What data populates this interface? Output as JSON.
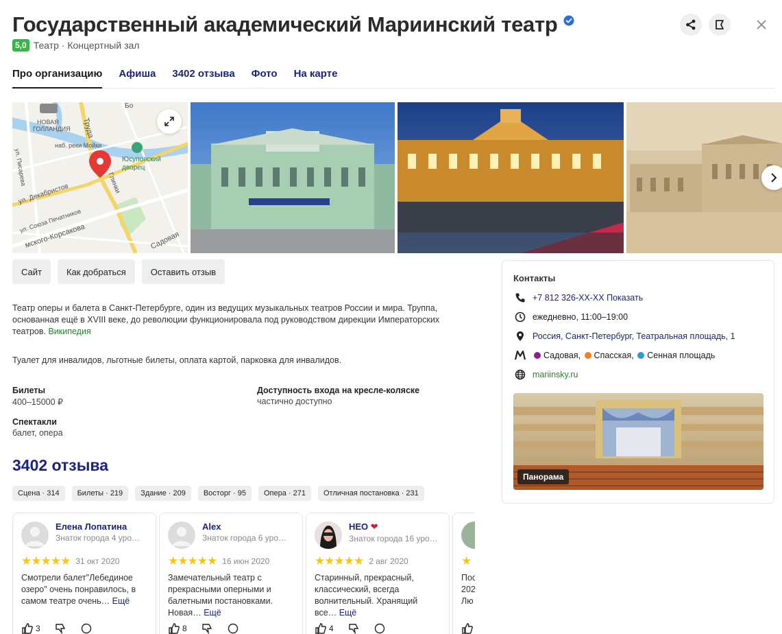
{
  "header": {
    "title": "Государственный академический Мариинский театр",
    "rating": "5,0",
    "categories": "Театр · Концертный зал"
  },
  "tabs": [
    {
      "label": "Про организацию",
      "active": true
    },
    {
      "label": "Афиша",
      "active": false
    },
    {
      "label": "3402 отзыва",
      "active": false
    },
    {
      "label": "Фото",
      "active": false
    },
    {
      "label": "На карте",
      "active": false
    }
  ],
  "map": {
    "labels": {
      "gollandia": "НОВАЯ\nГОЛЛАНДИЯ",
      "truda": "Труда",
      "moika": "наб. реки Мойки",
      "yusupov": "Юсуповский\nдворец",
      "pisareva": "ул. Писарева",
      "dekabristov": "ул. Декабристов",
      "glinki": "Глинки",
      "pechatnikov": "ул. Союза Печатников",
      "korsakova": "мского-Корсакова",
      "sadovaya": "Садовая",
      "bo": "Бо"
    }
  },
  "actions": {
    "site": "Сайт",
    "route": "Как добраться",
    "review": "Оставить отзыв"
  },
  "about": {
    "description": "Театр оперы и балета в Санкт-Петербурге, один из ведущих музыкальных театров России и мира. Труппа, основанная ещё в XVIII веке, до революции функционировала под руководством дирекции Императорских театров.",
    "wiki_link": "Википедия",
    "features": "Туалет для инвалидов, льготные билеты, оплата картой, парковка для инвалидов."
  },
  "facts": {
    "tickets_label": "Билеты",
    "tickets_value": "400–15000 ₽",
    "access_label": "Доступность входа на кресле-коляске",
    "access_value": "частично доступно",
    "shows_label": "Спектакли",
    "shows_value": "балет, опера"
  },
  "reviews": {
    "title": "3402 отзыва",
    "chips": [
      "Сцена · 314",
      "Билеты · 219",
      "Здание · 209",
      "Восторг · 95",
      "Опера · 271",
      "Отличная постановка · 231"
    ],
    "items": [
      {
        "name": "Елена Лопатина",
        "level": "Знаток города 4 уро…",
        "stars": "★★★★★",
        "date": "31 окт 2020",
        "text": "Смотрели балет\"Лебединое озеро\" очень понравилось, в самом театре очень…",
        "more": "Ещё",
        "likes": "3"
      },
      {
        "name": "Alex",
        "level": "Знаток города 6 уро…",
        "stars": "★★★★★",
        "date": "16 июн 2020",
        "text": "Замечательный театр с прекрасными оперными и балетными постановками. Новая…",
        "more": "Ещё",
        "likes": "8"
      },
      {
        "name": "HEO",
        "level": "Знаток города 16 уро…",
        "stars": "★★★★★",
        "date": "2 авг 2020",
        "text": "Старинный, прекрасный, классический, всегда волнительный. Хранящий все…",
        "more": "Ещё",
        "likes": "4"
      },
      {
        "name": "",
        "level": "",
        "stars": "★",
        "date": "",
        "text": "Пос 202 Лю",
        "more": "",
        "likes": ""
      }
    ]
  },
  "contacts": {
    "title": "Контакты",
    "phone": "+7 812 326-XX-XX",
    "phone_show": "Показать",
    "hours": "ежедневно, 11:00–19:00",
    "address": "Россия, Санкт-Петербург, Театральная площадь, 1",
    "metro": [
      {
        "name": "Садовая",
        "color": "#8e1f8e"
      },
      {
        "name": "Спасская",
        "color": "#f0821e"
      },
      {
        "name": "Сенная площадь",
        "color": "#2b9bd0"
      }
    ],
    "website": "mariinsky.ru",
    "panorama_label": "Панорама"
  },
  "colors": {
    "accent": "#1a237e",
    "rating_green": "#3bb34a",
    "link_green": "#2e7d32",
    "star": "#f5c518",
    "pin": "#e53935"
  }
}
